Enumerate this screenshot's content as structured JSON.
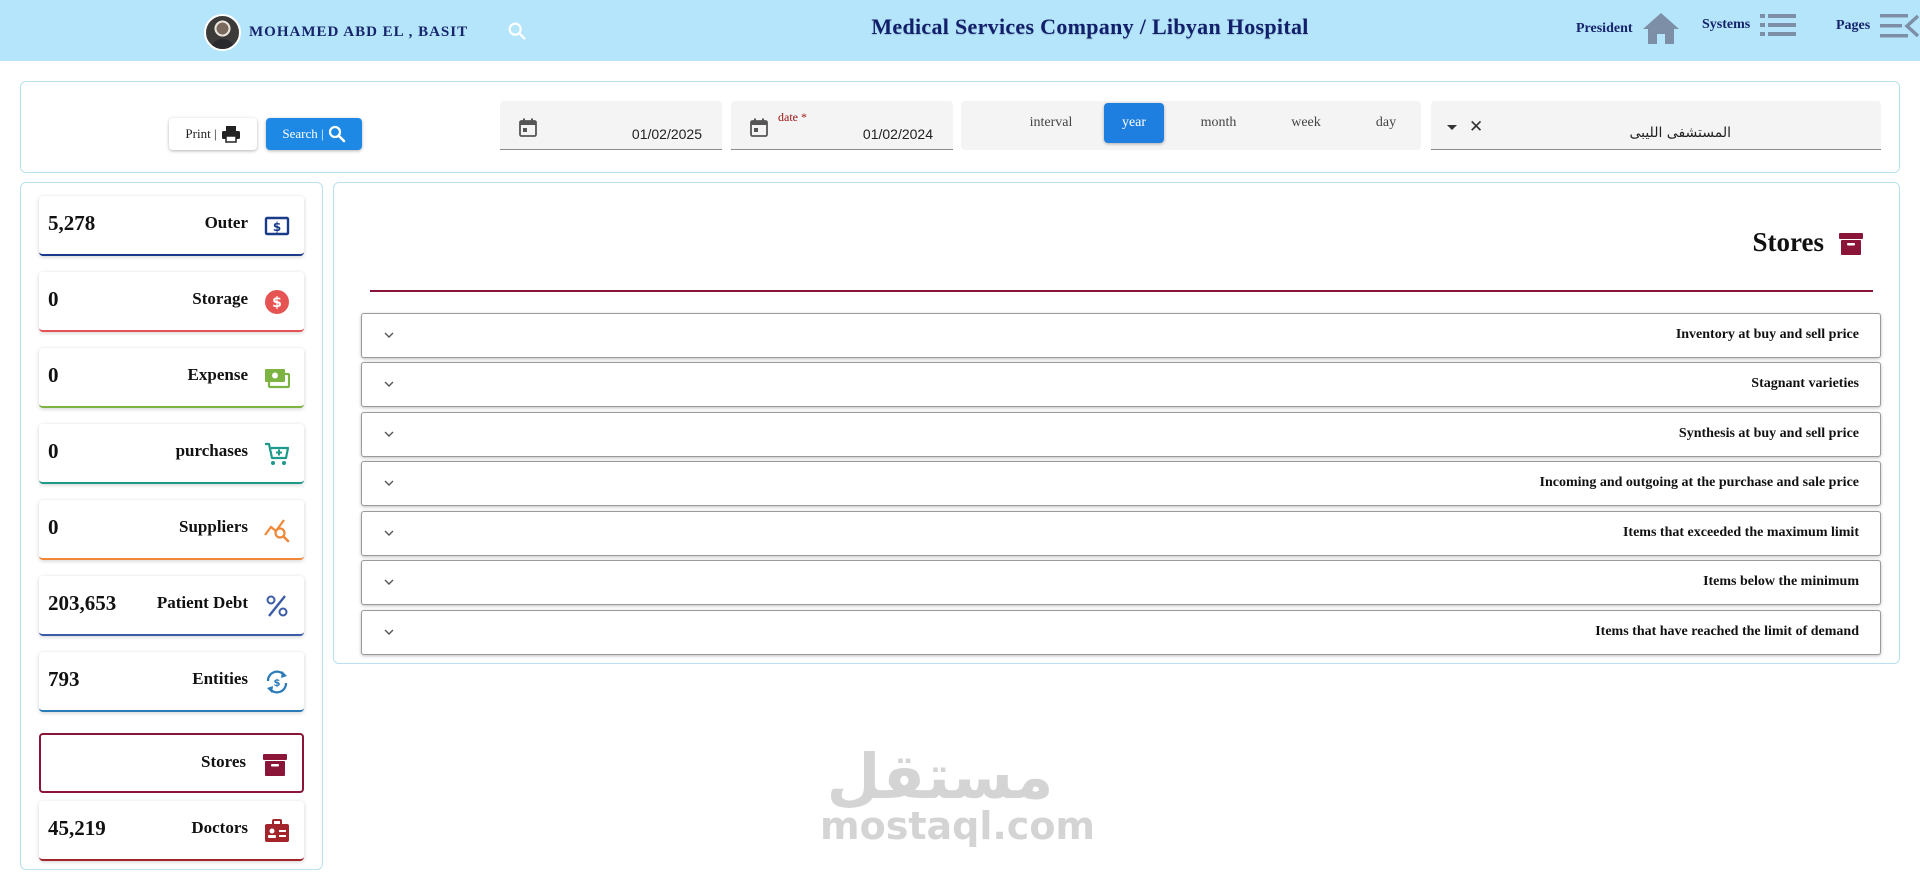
{
  "header": {
    "user_name": "MOHAMED ABD EL , BASIT",
    "brand": "Medical Services Company / Libyan Hospital",
    "nav": [
      {
        "label": "President",
        "icon": "home-icon"
      },
      {
        "label": "Systems",
        "icon": "list-icon"
      },
      {
        "label": "Pages",
        "icon": "menu-collapse-icon"
      }
    ]
  },
  "filters": {
    "print_label": "Print |",
    "search_label": "Search |",
    "date_to": "01/02/2025",
    "date_from_label": "date *",
    "date_from": "01/02/2024",
    "periods": [
      "interval",
      "year",
      "month",
      "week",
      "day"
    ],
    "active_period": "year",
    "hospital": "المستشفى الليبى"
  },
  "sidebar": {
    "stats": [
      {
        "label": "Outer",
        "value": "5,278",
        "icon": "dollar-bill-icon",
        "color": "#1a3a8a"
      },
      {
        "label": "Storage",
        "value": "0",
        "icon": "dollar-coin-icon",
        "color": "#e55353"
      },
      {
        "label": "Expense",
        "value": "0",
        "icon": "money-icon",
        "color": "#7cb342"
      },
      {
        "label": "purchases",
        "value": "0",
        "icon": "cart-icon",
        "color": "#1f9a8a"
      },
      {
        "label": "Suppliers",
        "value": "0",
        "icon": "search-trend-icon",
        "color": "#f0883a"
      },
      {
        "label": "Patient Debt",
        "value": "203,653",
        "icon": "percent-icon",
        "color": "#3b5ca8"
      },
      {
        "label": "Entities",
        "value": "793",
        "icon": "exchange-icon",
        "color": "#2b7bb9"
      },
      {
        "label": "Stores",
        "value": "",
        "icon": "archive-icon",
        "color": "#8b1538"
      },
      {
        "label": "Doctors",
        "value": "45,219",
        "icon": "id-badge-icon",
        "color": "#a4242b"
      }
    ]
  },
  "panel": {
    "title": "Stores",
    "items": [
      "Inventory at buy and sell price",
      "Stagnant varieties",
      "Synthesis at buy and sell price",
      "Incoming and outgoing at the purchase and sale price",
      "Items that exceeded the maximum limit",
      "Items below the minimum",
      "Items that have reached the limit of demand"
    ]
  },
  "watermark": {
    "arabic": "مستقل",
    "latin": "mostaql.com"
  },
  "colors": {
    "header_bg": "#b5e5fb",
    "accent": "#1e88e5",
    "stores": "#8b1538"
  }
}
